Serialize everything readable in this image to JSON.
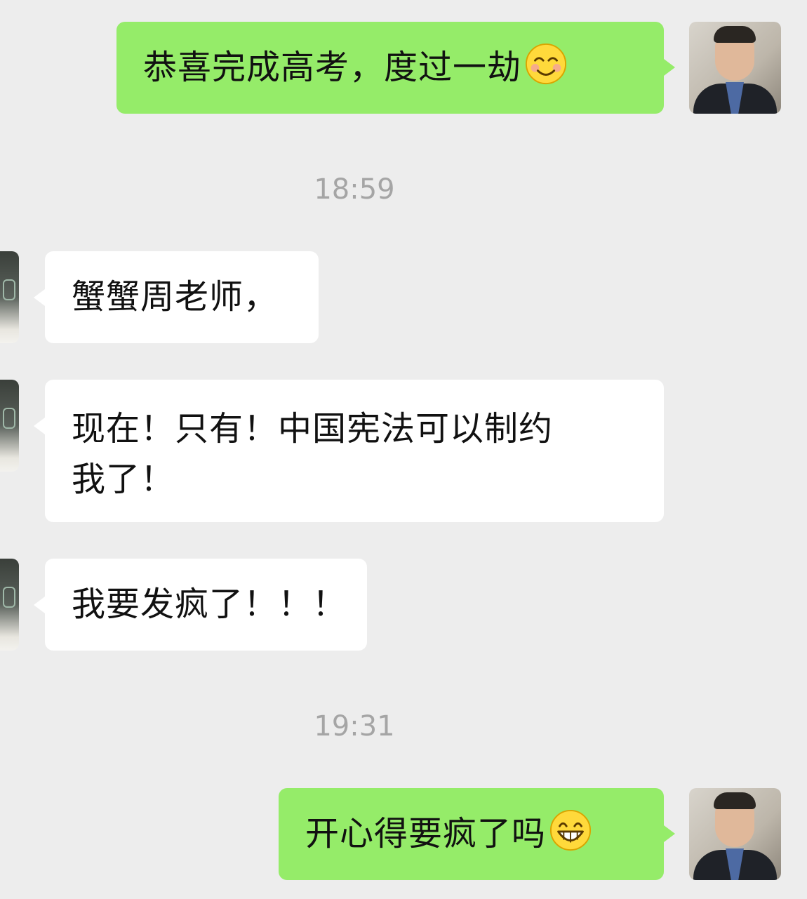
{
  "messages": [
    {
      "side": "sent",
      "text": "恭喜完成高考，度过一劫",
      "emoji": "smiling-face-icon"
    },
    {
      "type": "timestamp",
      "text": "18:59"
    },
    {
      "side": "received",
      "text": "蟹蟹周老师，"
    },
    {
      "side": "received",
      "line1": "现在！只有！中国宪法可以制约",
      "line2": "我了！"
    },
    {
      "side": "received",
      "text": "我要发疯了！！！"
    },
    {
      "type": "timestamp",
      "text": "19:31"
    },
    {
      "side": "sent",
      "text": "开心得要疯了吗",
      "emoji": "grinning-face-icon"
    }
  ],
  "colors": {
    "background": "#ededed",
    "sent_bubble": "#95ec69",
    "received_bubble": "#ffffff",
    "timestamp": "#a5a5a5"
  }
}
